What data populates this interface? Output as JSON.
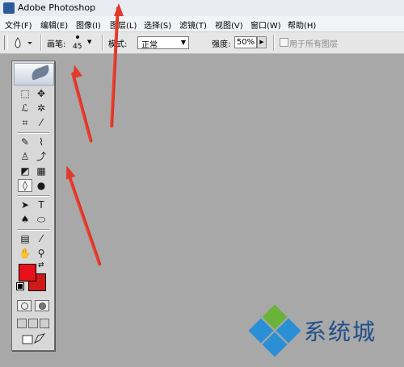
{
  "window": {
    "title": "Adobe Photoshop"
  },
  "menu": {
    "items": [
      "文件(F)",
      "编辑(E)",
      "图像(I)",
      "图层(L)",
      "选择(S)",
      "滤镜(T)",
      "视图(V)",
      "窗口(W)",
      "帮助(H)"
    ]
  },
  "options": {
    "brush_label": "画笔:",
    "brush_size": "45",
    "mode_label": "模式:",
    "mode_value": "正常",
    "strength_label": "强度:",
    "strength_value": "50%",
    "all_layers_label": "用于所有图层",
    "all_layers_checked": false
  },
  "toolbox": {
    "tools": [
      {
        "icon": "marquee-icon",
        "glyph": "⬚"
      },
      {
        "icon": "move-icon",
        "glyph": "✥"
      },
      {
        "icon": "lasso-icon",
        "glyph": "ℒ"
      },
      {
        "icon": "magic-wand-icon",
        "glyph": "✲"
      },
      {
        "icon": "crop-icon",
        "glyph": "⌗"
      },
      {
        "icon": "slice-icon",
        "glyph": "⁄"
      },
      {
        "icon": "healing-brush-icon",
        "glyph": "✎"
      },
      {
        "icon": "brush-icon",
        "glyph": "⌇"
      },
      {
        "icon": "clone-stamp-icon",
        "glyph": "♙"
      },
      {
        "icon": "history-brush-icon",
        "glyph": "⤴"
      },
      {
        "icon": "eraser-icon",
        "glyph": "◩"
      },
      {
        "icon": "gradient-icon",
        "glyph": "▦"
      },
      {
        "icon": "blur-icon",
        "glyph": "◊"
      },
      {
        "icon": "dodge-icon",
        "glyph": "●"
      },
      {
        "icon": "path-selection-icon",
        "glyph": "➤"
      },
      {
        "icon": "type-icon",
        "glyph": "T"
      },
      {
        "icon": "pen-icon",
        "glyph": "♠"
      },
      {
        "icon": "shape-icon",
        "glyph": "⬭"
      },
      {
        "icon": "notes-icon",
        "glyph": "▤"
      },
      {
        "icon": "eyedropper-icon",
        "glyph": "⁄"
      },
      {
        "icon": "hand-icon",
        "glyph": "✋"
      },
      {
        "icon": "zoom-icon",
        "glyph": "⚲"
      }
    ],
    "foreground_color": "#e8111b",
    "background_color": "#d01818"
  },
  "colors": {
    "arrow": "#e23a2a",
    "watermark_blue": "#2b8fd6",
    "watermark_green": "#6ab23a",
    "watermark_text": "#1f4f8a"
  },
  "watermark": {
    "text": "系统城"
  }
}
